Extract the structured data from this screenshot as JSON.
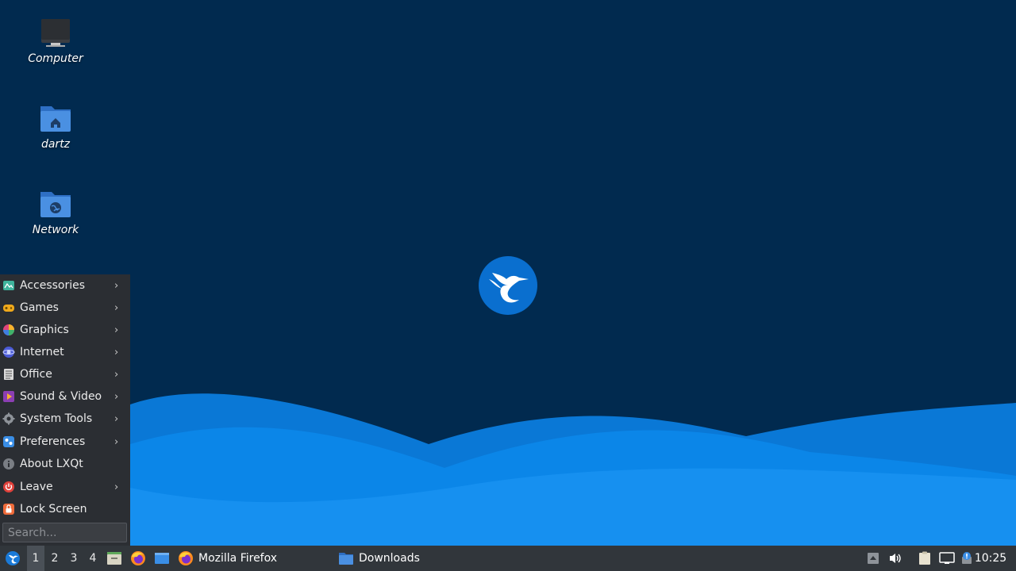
{
  "desktop": {
    "background_color": "#012a4f",
    "icons": [
      {
        "label": "Computer",
        "icon": "computer-icon"
      },
      {
        "label": "dartz",
        "icon": "home-folder-icon"
      },
      {
        "label": "Network",
        "icon": "network-folder-icon"
      }
    ],
    "center_logo": "lubuntu-bird-logo"
  },
  "start_menu": {
    "items": [
      {
        "label": "Accessories",
        "icon": "accessories-icon",
        "submenu": true
      },
      {
        "label": "Games",
        "icon": "games-icon",
        "submenu": true
      },
      {
        "label": "Graphics",
        "icon": "graphics-icon",
        "submenu": true
      },
      {
        "label": "Internet",
        "icon": "internet-icon",
        "submenu": true
      },
      {
        "label": "Office",
        "icon": "office-icon",
        "submenu": true
      },
      {
        "label": "Sound & Video",
        "icon": "sound-video-icon",
        "submenu": true
      },
      {
        "label": "System Tools",
        "icon": "system-tools-icon",
        "submenu": true
      },
      {
        "label": "Preferences",
        "icon": "preferences-icon",
        "submenu": true
      },
      {
        "label": "About LXQt",
        "icon": "info-icon",
        "submenu": false
      },
      {
        "label": "Leave",
        "icon": "power-icon",
        "submenu": true
      },
      {
        "label": "Lock Screen",
        "icon": "lock-icon",
        "submenu": false
      }
    ],
    "arrow": "›",
    "search": {
      "placeholder": "Search...",
      "value": ""
    }
  },
  "taskbar": {
    "desktops": [
      "1",
      "2",
      "3",
      "4"
    ],
    "active_desktop": "1",
    "quicklaunch": [
      "file-manager-icon",
      "firefox-icon",
      "show-desktop-icon"
    ],
    "tasks": [
      {
        "label": "Mozilla Firefox",
        "icon": "firefox-icon"
      },
      {
        "label": "Downloads",
        "icon": "folder-icon"
      }
    ],
    "tray": [
      "tray-expand-icon",
      "volume-icon",
      "clipboard-icon",
      "network-wired-icon",
      "update-notifier-icon"
    ],
    "clock": "10:25"
  }
}
